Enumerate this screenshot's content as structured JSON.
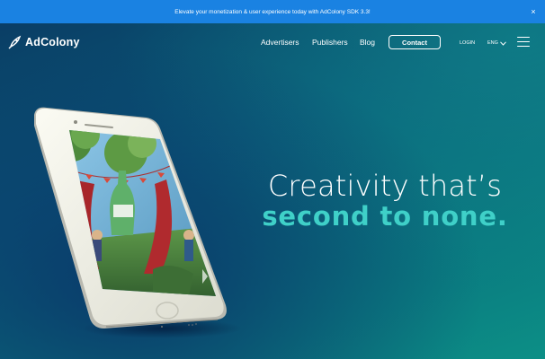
{
  "banner": {
    "text": "Elevate your monetization & user experience today with AdColony SDK 3.3!",
    "close_symbol": "×"
  },
  "nav": {
    "logo_text": "AdColony",
    "links": [
      "Advertisers",
      "Publishers",
      "Blog"
    ],
    "contact_label": "Contact",
    "login_label": "LOGIN",
    "language_label": "ENG"
  },
  "hero": {
    "title": "Creativity that’s",
    "subtitle": "second to none."
  },
  "colors": {
    "banner": "#1a82e2",
    "accent": "#3fd0c8"
  }
}
